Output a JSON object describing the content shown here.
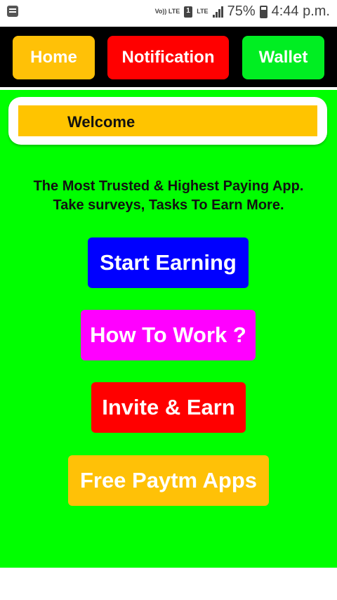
{
  "statusbar": {
    "volte": "Vo)) LTE",
    "lte": "LTE",
    "battery": "75%",
    "time": "4:44 p.m."
  },
  "nav": {
    "home": "Home",
    "notification": "Notification",
    "wallet": "Wallet"
  },
  "welcome": {
    "text": "Welcome"
  },
  "tagline": {
    "line1": "The Most Trusted & Highest Paying App.",
    "line2": "Take surveys, Tasks To Earn More."
  },
  "actions": {
    "start": "Start Earning",
    "how": "How To Work ?",
    "invite": "Invite & Earn",
    "paytm": "Free Paytm Apps"
  },
  "colors": {
    "background": "#00FF00",
    "home": "#FFC107",
    "notification": "#FF0000",
    "wallet": "#00EE22",
    "start": "#0000FF",
    "how": "#FF00FF",
    "invite": "#FF0000",
    "paytm": "#FFC107"
  },
  "icons": [
    "notification-list-icon",
    "sim-icon",
    "signal-icon",
    "battery-icon"
  ]
}
